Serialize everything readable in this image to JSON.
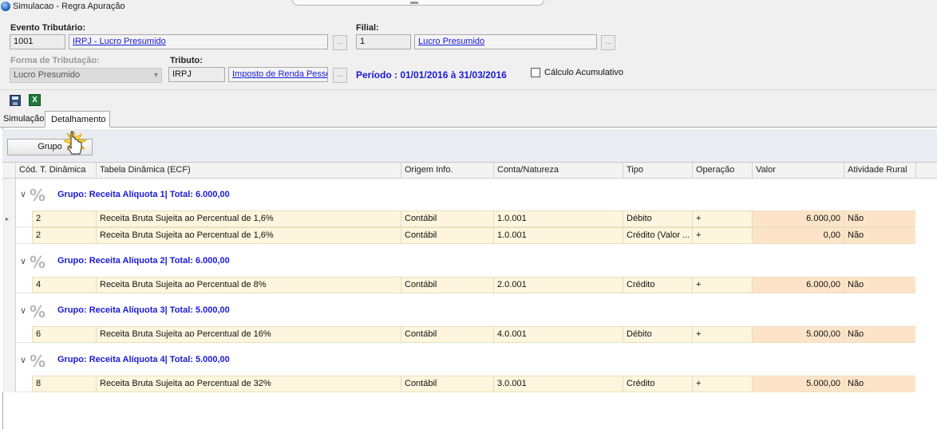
{
  "window": {
    "title": "Simulacao - Regra Apuração"
  },
  "form": {
    "evento_label": "Evento Tributário:",
    "evento_code": "1001",
    "evento_desc": "IRPJ - Lucro Presumido",
    "filial_label": "Filial:",
    "filial_code": "1",
    "filial_desc": "Lucro Presumido",
    "forma_label": "Forma de Tributação:",
    "forma_value": "Lucro Presumido",
    "tributo_label": "Tributo:",
    "tributo_code": "IRPJ",
    "tributo_desc": "Imposto de Renda Pessoa",
    "periodo": "Período : 01/01/2016 à 31/03/2016",
    "calculo_label": "Cálculo Acumulativo",
    "dots": "..."
  },
  "toolbar": {
    "save_icon": "save-icon",
    "excel_icon": "excel-icon"
  },
  "tabs": [
    {
      "label": "Simulação",
      "active": false
    },
    {
      "label": "Detalhamento",
      "active": true
    }
  ],
  "group_button": "Grupo",
  "columns": [
    "Cód. T. Dinâmica",
    "Tabela Dinâmica (ECF)",
    "Origem Info.",
    "Conta/Natureza",
    "Tipo",
    "Operação",
    "Valor",
    "Atividade Rural"
  ],
  "groups": [
    {
      "title": "Grupo: Receita Alíquota 1| Total: 6.000,00",
      "rows": [
        {
          "cod": "2",
          "tabela": "Receita Bruta Sujeita ao Percentual de 1,6%",
          "origem": "Contábil",
          "conta": "1.0.001",
          "tipo": "Débito",
          "operacao": "+",
          "valor": "6.000,00",
          "rural": "Não"
        },
        {
          "cod": "2",
          "tabela": "Receita Bruta Sujeita ao Percentual de 1,6%",
          "origem": "Contábil",
          "conta": "1.0.001",
          "tipo": "Crédito (Valor ...",
          "operacao": "+",
          "valor": "0,00",
          "rural": "Não"
        }
      ]
    },
    {
      "title": "Grupo: Receita Alíquota 2| Total: 6.000,00",
      "rows": [
        {
          "cod": "4",
          "tabela": "Receita Bruta Sujeita ao Percentual de 8%",
          "origem": "Contábil",
          "conta": "2.0.001",
          "tipo": "Crédito",
          "operacao": "+",
          "valor": "6.000,00",
          "rural": "Não"
        }
      ]
    },
    {
      "title": "Grupo: Receita Alíquota 3| Total: 5.000,00",
      "rows": [
        {
          "cod": "6",
          "tabela": "Receita Bruta Sujeita ao Percentual de 16%",
          "origem": "Contábil",
          "conta": "4.0.001",
          "tipo": "Débito",
          "operacao": "+",
          "valor": "5.000,00",
          "rural": "Não"
        }
      ]
    },
    {
      "title": "Grupo: Receita Alíquota 4| Total: 5.000,00",
      "rows": [
        {
          "cod": "8",
          "tabela": "Receita Bruta Sujeita ao Percentual de 32%",
          "origem": "Contábil",
          "conta": "3.0.001",
          "tipo": "Crédito",
          "operacao": "+",
          "valor": "5.000,00",
          "rural": "Não"
        }
      ]
    }
  ],
  "icons": {
    "group_icon": "percent-icon",
    "expand_icon": "chevron-down-icon",
    "row_indicator": "row-pointer-icon"
  },
  "glyphs": {
    "percent": "%",
    "chevron": "∨",
    "pointer": "▸"
  }
}
